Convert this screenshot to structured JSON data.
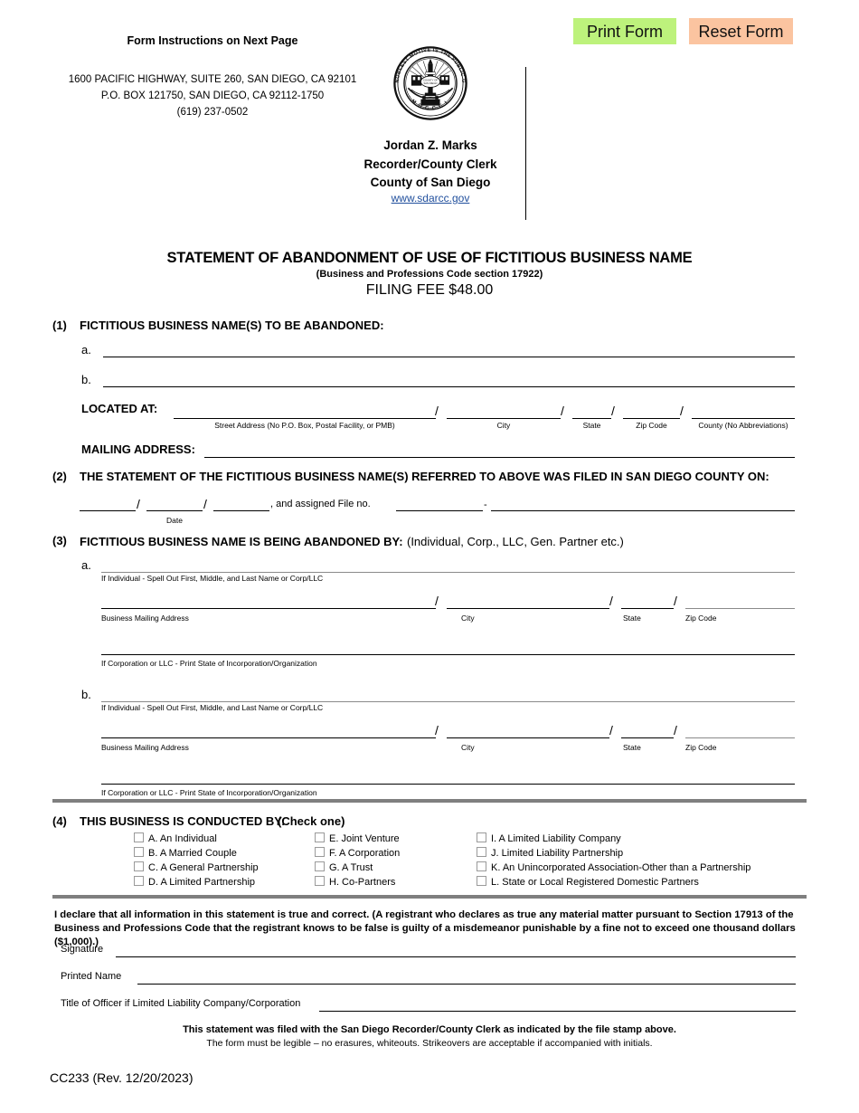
{
  "toolbar": {
    "print_label": "Print Form",
    "reset_label": "Reset Form",
    "print_color": "#bdf27c",
    "reset_color": "#fbc4a0"
  },
  "header": {
    "instructions": "Form Instructions on Next Page",
    "address_line_1": "1600 PACIFIC HIGHWAY, SUITE 260, SAN DIEGO, CA 92101",
    "address_line_2": "P.O. BOX 121750, SAN DIEGO, CA 92112-1750",
    "phone": "(619) 237-0502",
    "seal_motto": "THE NOBLEST MOTIVE IS THE PUBLIC GOOD",
    "seal_year": "MDCCCL",
    "recorder_name": "Jordan Z. Marks",
    "recorder_title": "Recorder/County Clerk",
    "recorder_county": "County of San Diego",
    "website": "www.sdarcc.gov",
    "website_color": "#1f4e9c"
  },
  "title": {
    "main": "STATEMENT OF ABANDONMENT OF USE OF FICTITIOUS BUSINESS NAME",
    "sub": "(Business and Professions Code section 17922)",
    "fee": "FILING FEE $48.00"
  },
  "section1": {
    "number": "(1)",
    "heading": "FICTITIOUS BUSINESS NAME(S) TO BE ABANDONED",
    "heading_colon": ":",
    "item_a": "a.",
    "item_b": "b.",
    "located_label": "LOCATED AT:",
    "located_fields": [
      "Street Address (No P.O. Box, Postal Facility, or PMB)",
      "City",
      "State",
      "Zip Code",
      "County (No Abbreviations)"
    ],
    "mailing_label": "MAILING ADDRESS:"
  },
  "section2": {
    "number": "(2)",
    "heading": "THE STATEMENT OF THE FICTITIOUS BUSINESS NAME(S) REFERRED TO ABOVE WAS FILED IN SAN DIEGO COUNTY ON",
    "heading_colon": ":",
    "date_label": "Date",
    "slash": "/",
    "file_no_text": ", and assigned File no.",
    "dash": "-"
  },
  "section3": {
    "number": "(3)",
    "heading": "FICTITIOUS BUSINESS NAME IS BEING ABANDONED BY:",
    "heading_suffix": "(Individual, Corp., LLC, Gen. Partner etc.)",
    "blocks": [
      {
        "letter": "a.",
        "name_caption": "If Individual - Spell Out First, Middle, and Last Name or Corp/LLC",
        "address_caption": "Business Mailing Address",
        "city_caption": "City",
        "state_caption": "State",
        "zip_caption": "Zip Code",
        "incorporation_caption": "If Corporation or LLC - Print State of Incorporation/Organization",
        "slash": "/"
      },
      {
        "letter": "b.",
        "name_caption": "If Individual - Spell Out First, Middle, and Last Name or Corp/LLC",
        "address_caption": "Business Mailing Address",
        "city_caption": "City",
        "state_caption": "State",
        "zip_caption": "Zip Code",
        "incorporation_caption": "If Corporation or LLC - Print State of Incorporation/Organization",
        "slash": "/"
      }
    ]
  },
  "section4": {
    "number": "(4)",
    "heading": "THIS BUSINESS IS CONDUCTED BY:",
    "check_one": "(Check one)",
    "column_1": [
      "A. An Individual",
      "B. A Married Couple",
      "C. A General Partnership",
      "D. A Limited Partnership"
    ],
    "column_2": [
      "E. Joint Venture",
      "F. A Corporation",
      "G. A Trust",
      "H. Co-Partners"
    ],
    "column_3": [
      "I. A Limited Liability Company",
      "J. Limited Liability Partnership",
      "K. An Unincorporated Association-Other than a Partnership",
      "L. State or Local Registered Domestic Partners"
    ]
  },
  "declaration": {
    "text": "I declare that all information in this statement is true and correct. (A registrant who declares as true any material matter pursuant to Section 17913 of the Business and Professions Code that the registrant knows to be false is guilty of a misdemeanor punishable by a fine not to exceed one thousand dollars ($1,000).)",
    "signature_label": "Signature",
    "printed_name_label": "Printed Name",
    "title_officer_label": "Title of Officer if Limited Liability Company/Corporation"
  },
  "footer": {
    "note_1": "This statement was filed with the San Diego Recorder/County Clerk as indicated by the file stamp above.",
    "note_2": "The form must be legible – no erasures, whiteouts. Strikeovers are acceptable if accompanied with initials.",
    "form_code": "CC233 (Rev. 12/20/2023)"
  }
}
